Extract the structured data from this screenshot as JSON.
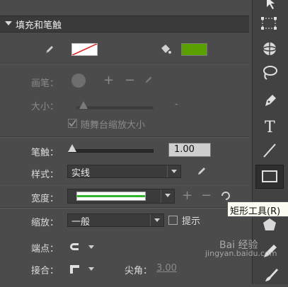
{
  "panel": {
    "title": "填充和笔触",
    "fill_color": "#5aa000",
    "pen_label": "画笔：",
    "size_label": "大小：",
    "scale_with_stage_label": "随舞台缩放大小",
    "stroke_label": "笔触：",
    "stroke_value": "1.00",
    "style_label": "样式：",
    "style_value": "实线",
    "width_label": "宽度：",
    "scale_label": "缩放：",
    "scale_value": "一般",
    "hint_label": "提示",
    "cap_label": "端点：",
    "join_label": "接合：",
    "miter_label": "尖角：",
    "miter_value": "3.00"
  },
  "tooltip": "矩形工具(R)",
  "watermark": {
    "logo": "Bai 经验",
    "url": "jingyan.baidu.com"
  },
  "toolbar": {
    "tools": [
      "selection-arrow",
      "free-transform",
      "3d-rotation",
      "lasso",
      "pen",
      "text",
      "line",
      "rectangle",
      "polystar",
      "pencil",
      "brush"
    ]
  }
}
